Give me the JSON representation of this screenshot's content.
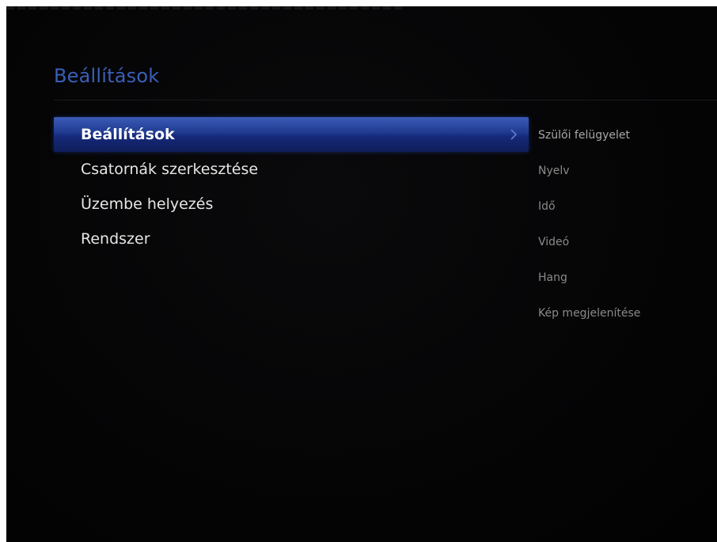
{
  "page_title": "Beállítások",
  "main_menu": {
    "items": [
      {
        "label": "Beállítások",
        "selected": true
      },
      {
        "label": "Csatornák szerkesztése",
        "selected": false
      },
      {
        "label": "Üzembe helyezés",
        "selected": false
      },
      {
        "label": "Rendszer",
        "selected": false
      }
    ],
    "selected_icon": "chevron-right-icon"
  },
  "submenu": {
    "items": [
      {
        "label": "Szülői felügyelet"
      },
      {
        "label": "Nyelv"
      },
      {
        "label": "Idő"
      },
      {
        "label": "Videó"
      },
      {
        "label": "Hang"
      },
      {
        "label": "Kép megjelenítése"
      }
    ]
  },
  "colors": {
    "background": "#040405",
    "title": "#3a5fb8",
    "selection": "#1f3a8e",
    "menu_text": "#e6e6e6",
    "submenu_text": "#8a8a8a"
  }
}
